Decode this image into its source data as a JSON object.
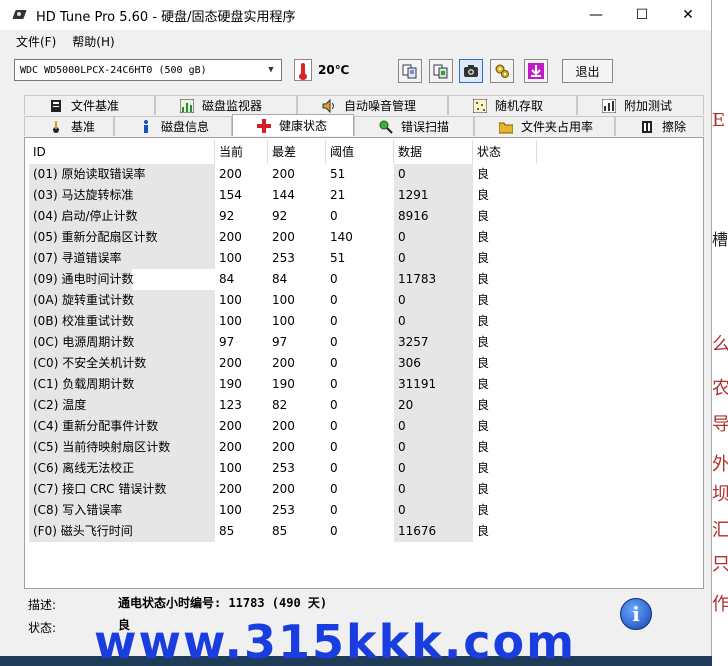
{
  "window": {
    "title": "HD Tune Pro 5.60 - 硬盘/固态硬盘实用程序",
    "controls": {
      "minimize": "—",
      "maximize": "☐",
      "close": "✕"
    }
  },
  "menu": [
    {
      "label": "文件(F)"
    },
    {
      "label": "帮助(H)"
    }
  ],
  "toolbar": {
    "drive": "WDC WD5000LPCX-24C6HT0 (500 gB)",
    "temperature": "20℃",
    "exit_label": "退出"
  },
  "tabs_top": [
    {
      "label": "文件基准",
      "icon": "file-benchmark-icon"
    },
    {
      "label": "磁盘监视器",
      "icon": "disk-monitor-icon"
    },
    {
      "label": "自动噪音管理",
      "icon": "speaker-icon"
    },
    {
      "label": "随机存取",
      "icon": "random-access-icon"
    },
    {
      "label": "附加测试",
      "icon": "extra-tests-icon"
    }
  ],
  "tabs_bottom": [
    {
      "label": "基准",
      "icon": "benchmark-icon"
    },
    {
      "label": "磁盘信息",
      "icon": "info-icon"
    },
    {
      "label": "健康状态",
      "icon": "health-cross-icon",
      "selected": true
    },
    {
      "label": "错误扫描",
      "icon": "magnifier-icon"
    },
    {
      "label": "文件夹占用率",
      "icon": "folder-icon"
    },
    {
      "label": "擦除",
      "icon": "erase-icon"
    }
  ],
  "table": {
    "headers": [
      "ID",
      "当前",
      "最差",
      "阈值",
      "数据",
      "状态"
    ],
    "rows": [
      [
        "(01) 原始读取错误率",
        "200",
        "200",
        "51",
        "0",
        "良"
      ],
      [
        "(03) 马达旋转标准",
        "154",
        "144",
        "21",
        "1291",
        "良"
      ],
      [
        "(04) 启动/停止计数",
        "92",
        "92",
        "0",
        "8916",
        "良"
      ],
      [
        "(05) 重新分配扇区计数",
        "200",
        "200",
        "140",
        "0",
        "良"
      ],
      [
        "(07) 寻道错误率",
        "100",
        "253",
        "51",
        "0",
        "良"
      ],
      [
        "(09) 通电时间计数",
        "84",
        "84",
        "0",
        "11783",
        "良"
      ],
      [
        "(0A) 旋转重试计数",
        "100",
        "100",
        "0",
        "0",
        "良"
      ],
      [
        "(0B) 校准重试计数",
        "100",
        "100",
        "0",
        "0",
        "良"
      ],
      [
        "(0C) 电源周期计数",
        "97",
        "97",
        "0",
        "3257",
        "良"
      ],
      [
        "(C0) 不安全关机计数",
        "200",
        "200",
        "0",
        "306",
        "良"
      ],
      [
        "(C1) 负载周期计数",
        "190",
        "190",
        "0",
        "31191",
        "良"
      ],
      [
        "(C2) 温度",
        "123",
        "82",
        "0",
        "20",
        "良"
      ],
      [
        "(C4) 重新分配事件计数",
        "200",
        "200",
        "0",
        "0",
        "良"
      ],
      [
        "(C5) 当前待映射扇区计数",
        "200",
        "200",
        "0",
        "0",
        "良"
      ],
      [
        "(C6) 离线无法校正",
        "100",
        "253",
        "0",
        "0",
        "良"
      ],
      [
        "(C7) 接口 CRC 错误计数",
        "200",
        "200",
        "0",
        "0",
        "良"
      ],
      [
        "(C8) 写入错误率",
        "100",
        "253",
        "0",
        "0",
        "良"
      ],
      [
        "(F0) 磁头飞行时间",
        "85",
        "85",
        "0",
        "11676",
        "良"
      ]
    ]
  },
  "footer": {
    "description_label": "描述:",
    "description_value": "通电状态小时编号: 11783 (490 天)",
    "status_label": "状态:",
    "status_value": "良"
  },
  "watermark": "www.315kkk.com",
  "colors": {
    "watermark": "#1a3de0",
    "health_icon": "#d42020"
  }
}
